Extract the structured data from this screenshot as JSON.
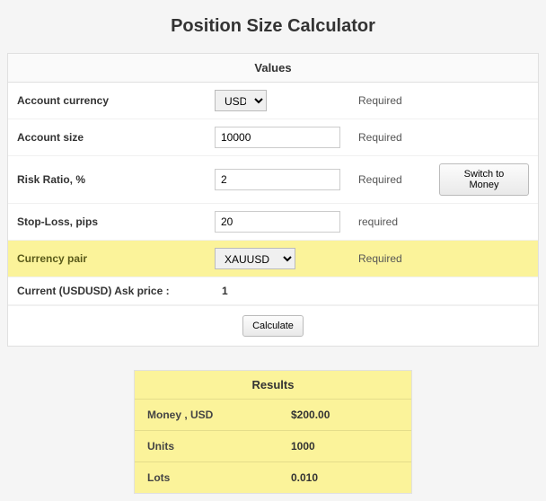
{
  "title": "Position Size Calculator",
  "panel_header": "Values",
  "required_label": "Required",
  "required_label_lc": "required",
  "rows": {
    "account_currency": {
      "label": "Account currency",
      "value": "USD"
    },
    "account_size": {
      "label": "Account size",
      "value": "10000"
    },
    "risk_ratio": {
      "label": "Risk Ratio, %",
      "value": "2"
    },
    "stop_loss": {
      "label": "Stop-Loss, pips",
      "value": "20"
    },
    "currency_pair": {
      "label": "Currency pair",
      "value": "XAUUSD"
    },
    "ask_price": {
      "label": "Current (USDUSD) Ask price :",
      "value": "1"
    }
  },
  "buttons": {
    "switch_money": "Switch to Money",
    "calculate": "Calculate"
  },
  "results": {
    "header": "Results",
    "money": {
      "label": "Money , USD",
      "value": "$200.00"
    },
    "units": {
      "label": "Units",
      "value": "1000"
    },
    "lots": {
      "label": "Lots",
      "value": "0.010"
    }
  }
}
